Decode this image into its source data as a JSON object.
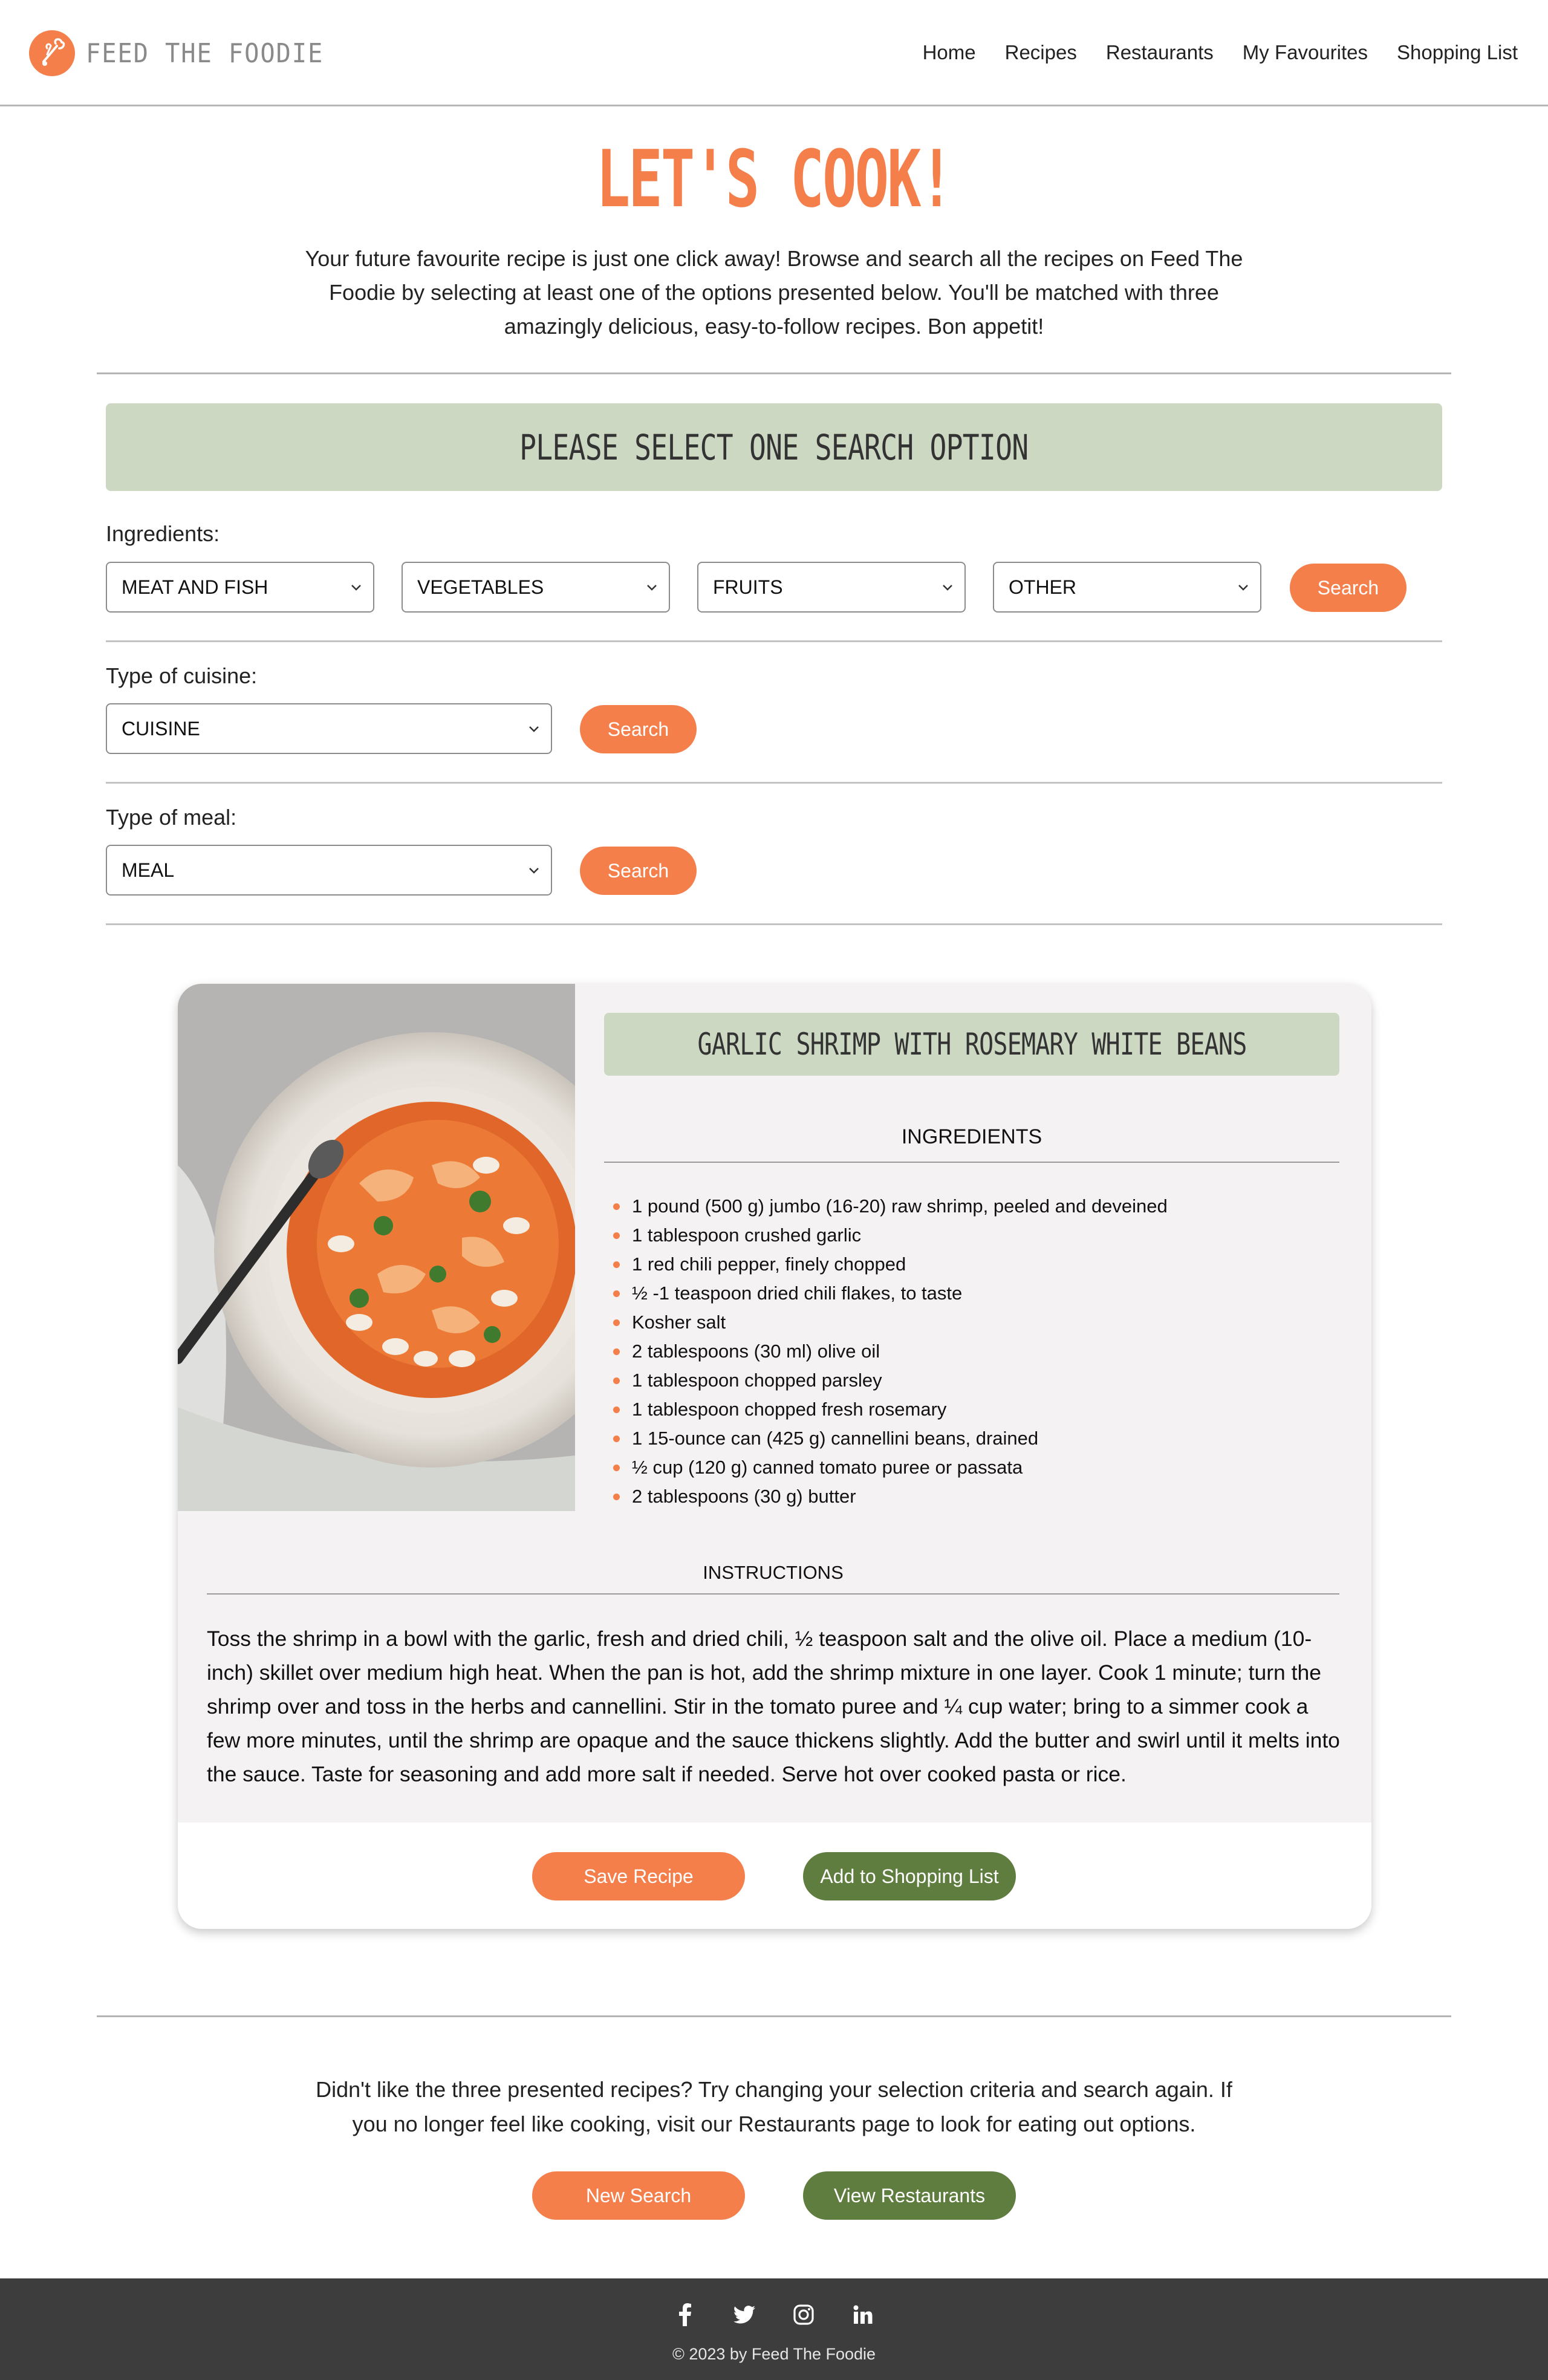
{
  "brand": {
    "name": "FEED THE FOODIE",
    "logo_icon": "chef-hat-icon",
    "accent": "#f47f4b",
    "green": "#5e7d3f",
    "banner_bg": "#cdd8c3"
  },
  "nav": {
    "items": [
      {
        "label": "Home"
      },
      {
        "label": "Recipes"
      },
      {
        "label": "Restaurants"
      },
      {
        "label": "My Favourites"
      },
      {
        "label": "Shopping List"
      }
    ]
  },
  "hero": {
    "title": "LET'S COOK!",
    "intro": "Your future favourite recipe is just one click away! Browse and search all the recipes on Feed The Foodie by selecting at least one of the options presented below. You'll be matched with three amazingly delicious, easy-to-follow recipes. Bon appetit!"
  },
  "search": {
    "banner": "PLEASE SELECT ONE SEARCH OPTION",
    "ingredients": {
      "label": "Ingredients:",
      "selects": [
        "MEAT AND FISH",
        "VEGETABLES",
        "FRUITS",
        "OTHER"
      ],
      "button": "Search"
    },
    "cuisine": {
      "label": "Type of cuisine:",
      "select": "CUISINE",
      "button": "Search"
    },
    "meal": {
      "label": "Type of meal:",
      "select": "MEAL",
      "button": "Search"
    }
  },
  "recipe": {
    "title": "GARLIC SHRIMP WITH ROSEMARY WHITE BEANS",
    "image_alt": "garlic-shrimp-bowl",
    "ingredients_heading": "INGREDIENTS",
    "ingredients": [
      "1 pound (500 g) jumbo (16-20) raw shrimp, peeled and deveined",
      "1 tablespoon crushed garlic",
      "1 red chili pepper, finely chopped",
      "½ -1 teaspoon dried chili flakes, to taste",
      "Kosher salt",
      "2 tablespoons (30 ml) olive oil",
      "1 tablespoon chopped parsley",
      "1 tablespoon chopped fresh rosemary",
      "1 15-ounce can (425 g) cannellini beans, drained",
      "½ cup (120 g) canned tomato puree or passata",
      "2 tablespoons (30 g) butter"
    ],
    "instructions_heading": "INSTRUCTIONS",
    "instructions": "Toss the shrimp in a bowl with the garlic, fresh and dried chili, ½ teaspoon salt and the olive oil. Place a medium (10-inch) skillet over medium high heat. When the pan is hot, add the shrimp mixture in one layer. Cook 1 minute; turn the shrimp over and toss in the herbs and cannellini. Stir in the tomato puree and ¼ cup water; bring to a simmer cook a few more minutes, until the shrimp are opaque and the sauce thickens slightly. Add the butter and swirl until it melts into the sauce. Taste for seasoning and add more salt if needed. Serve hot over cooked pasta or rice.",
    "save_label": "Save Recipe",
    "shopping_label": "Add to Shopping List"
  },
  "outro": {
    "text": "Didn't like the three presented recipes? Try changing your selection criteria and search again. If you no longer feel like cooking, visit our Restaurants page to look for eating out options.",
    "new_search": "New Search",
    "view_restaurants": "View Restaurants"
  },
  "footer": {
    "social": [
      "facebook-icon",
      "twitter-icon",
      "instagram-icon",
      "linkedin-icon"
    ],
    "copyright": "© 2023 by Feed The Foodie"
  }
}
